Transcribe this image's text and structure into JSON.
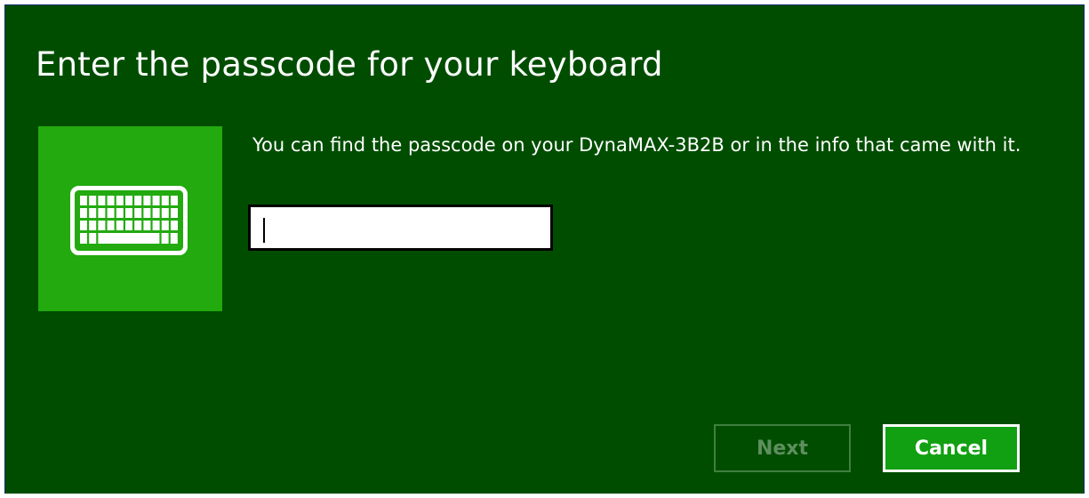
{
  "dialog": {
    "title": "Enter the passcode for your keyboard",
    "message": "You can find the passcode on your DynaMAX-3B2B or in the info that came with it.",
    "tile_icon": "keyboard-icon",
    "passcode_value": "",
    "next_label": "Next",
    "cancel_label": "Cancel",
    "next_enabled": false
  },
  "colors": {
    "background": "#004d00",
    "tile": "#22aa0f",
    "cancel_button": "#11a011",
    "disabled_text": "#5e8f5e",
    "text": "#ffffff"
  }
}
